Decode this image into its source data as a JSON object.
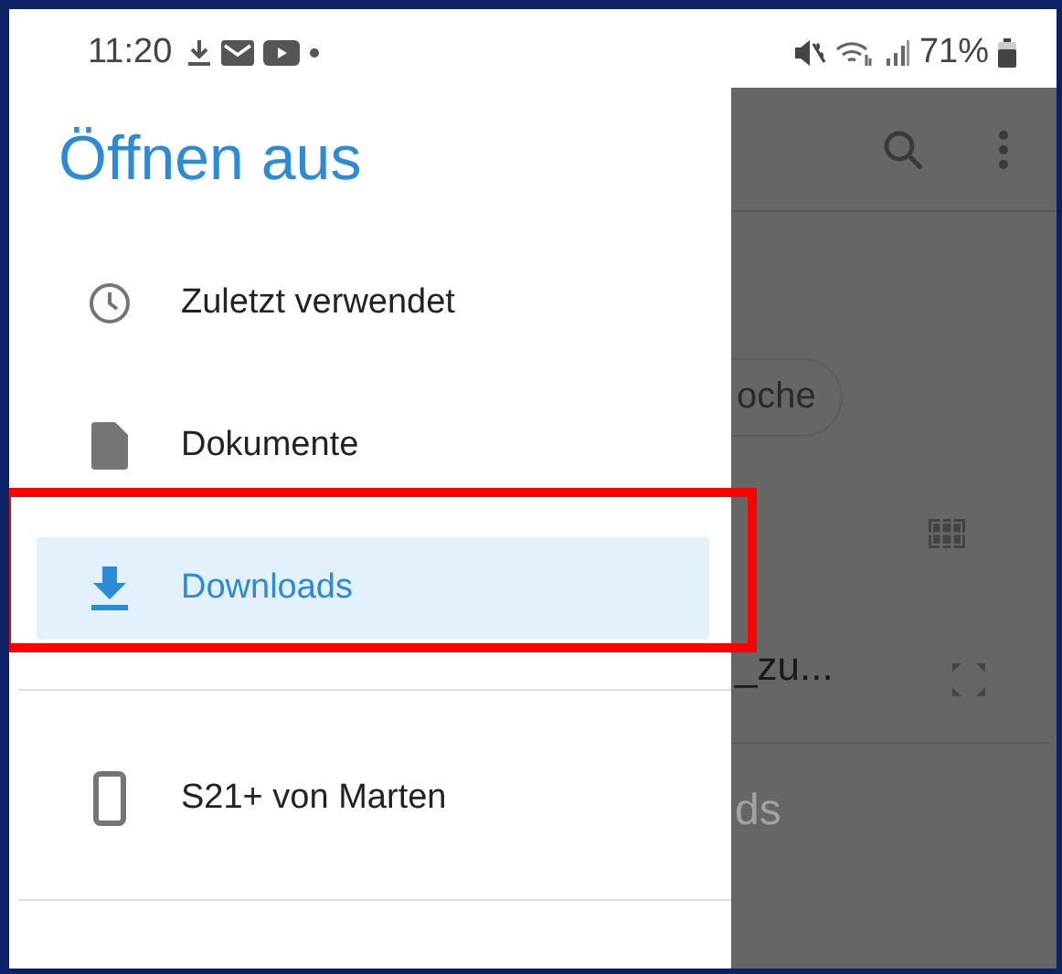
{
  "status_bar": {
    "time": "11:20",
    "battery": "71%"
  },
  "drawer": {
    "title": "Öffnen aus",
    "sections": [
      {
        "items": [
          {
            "kind": "recent",
            "label": "Zuletzt verwendet",
            "selected": false,
            "framed": false
          },
          {
            "kind": "document",
            "label": "Dokumente",
            "selected": false,
            "framed": false
          },
          {
            "kind": "download",
            "label": "Downloads",
            "selected": true,
            "framed": true
          }
        ]
      },
      {
        "items": [
          {
            "kind": "device",
            "label": "S21+ von Marten",
            "selected": false,
            "framed": false
          }
        ]
      }
    ]
  },
  "background": {
    "chip": "oche",
    "file_name": "_zu...",
    "section_label": "ds"
  }
}
